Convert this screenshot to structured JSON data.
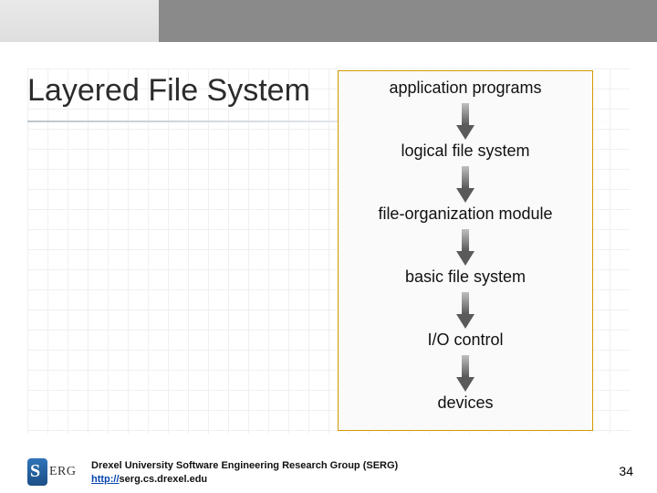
{
  "header": {
    "title": "Layered File System"
  },
  "diagram": {
    "layers": [
      "application programs",
      "logical file system",
      "file-organization module",
      "basic file system",
      "I/O control",
      "devices"
    ]
  },
  "footer": {
    "logo": {
      "initial": "S",
      "word": "ERG"
    },
    "credit_line1": "Drexel University Software Engineering Research Group (SERG)",
    "link_scheme": "http://",
    "link_rest": "serg.cs.drexel.edu",
    "page_number": "34"
  }
}
